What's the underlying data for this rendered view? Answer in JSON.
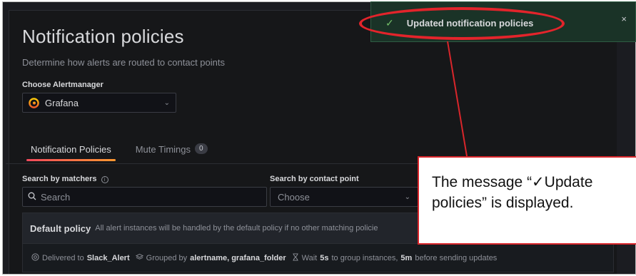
{
  "page": {
    "title": "Notification policies",
    "subtitle": "Determine how alerts are routed to contact points"
  },
  "alertmanager": {
    "label": "Choose Alertmanager",
    "value": "Grafana",
    "icon": "grafana-icon"
  },
  "tabs": [
    {
      "label": "Notification Policies",
      "active": true
    },
    {
      "label": "Mute Timings",
      "count": "0",
      "active": false
    }
  ],
  "filters": {
    "matchers_label": "Search by matchers",
    "search_placeholder": "Search",
    "contact_label": "Search by contact point",
    "contact_value": "Choose"
  },
  "policy": {
    "title": "Default policy",
    "description": "All alert instances will be handled by the default policy if no other matching policie",
    "delivered_prefix": "Delivered to",
    "contact_point": "Slack_Alert",
    "grouped_prefix": "Grouped by",
    "group_by": "alertname, grafana_folder",
    "wait_prefix": "Wait",
    "group_wait": "5s",
    "group_wait_suffix": "to group instances,",
    "repeat": "5m",
    "repeat_suffix": "before sending updates"
  },
  "toast": {
    "message": "Updated notification policies",
    "check": "✓",
    "close": "×",
    "status_color": "#73bf69"
  },
  "annotation": {
    "line1": "The message “✓Update",
    "line2": "policies” is displayed.",
    "border_color": "#d9262b"
  }
}
